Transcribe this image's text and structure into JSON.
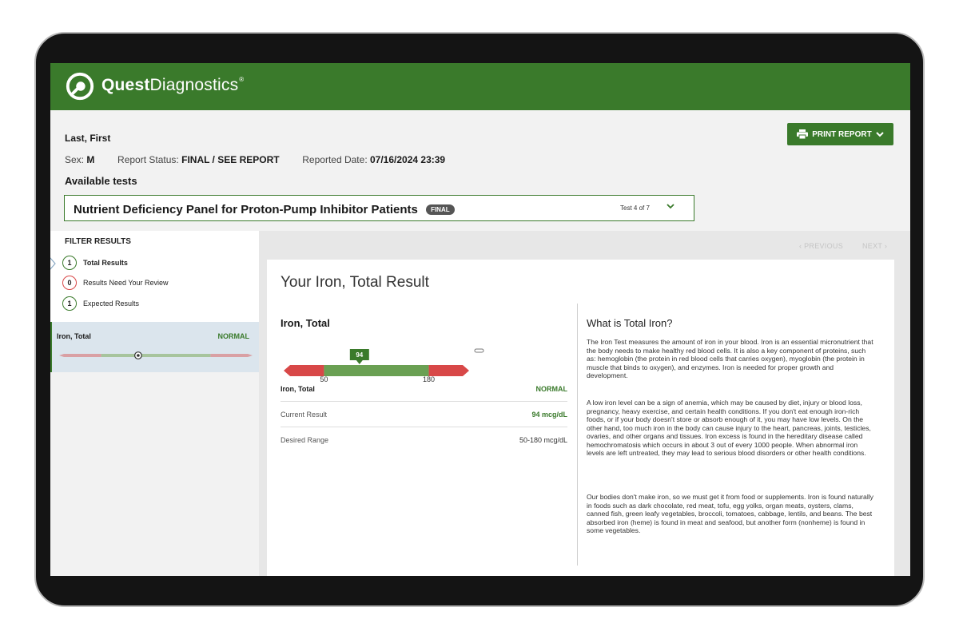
{
  "brand": {
    "name_bold": "Quest",
    "name_light": "Diagnostics",
    "trademark": "®",
    "color": "#3a7a2b"
  },
  "patient": {
    "name": "Last, First",
    "sex_label": "Sex:",
    "sex": "M",
    "status_label": "Report Status:",
    "status": "FINAL / SEE REPORT",
    "date_label": "Reported Date:",
    "date": "07/16/2024 23:39"
  },
  "print_button": {
    "label": "PRINT REPORT"
  },
  "available_tests": {
    "heading": "Available tests",
    "selected": "Nutrient Deficiency Panel for Proton-Pump Inhibitor Patients",
    "badge": "FINAL",
    "count": "Test 4 of 7"
  },
  "filter": {
    "title": "FILTER RESULTS",
    "items": [
      {
        "count": "1",
        "label": "Total Results",
        "color": "#3a7a2b"
      },
      {
        "count": "0",
        "label": "Results Need Your Review",
        "color": "#d84848"
      },
      {
        "count": "1",
        "label": "Expected Results",
        "color": "#3a7a2b"
      }
    ]
  },
  "result_card": {
    "name": "Iron, Total",
    "status": "NORMAL"
  },
  "pager": {
    "previous": "‹ PREVIOUS",
    "next": "NEXT ›"
  },
  "detail": {
    "title": "Your Iron, Total Result",
    "test_name": "Iron, Total",
    "range_chart": {
      "value": 94,
      "low": 50,
      "high": 180,
      "value_label": "94",
      "low_label": "50",
      "high_label": "180"
    },
    "summary": {
      "name": "Iron, Total",
      "status": "NORMAL"
    },
    "current_result": {
      "label": "Current Result",
      "value": "94 mcg/dL"
    },
    "desired_range": {
      "label": "Desired Range",
      "value": "50-180 mcg/dL"
    },
    "info_heading": "What is Total Iron?",
    "paragraphs": [
      "The Iron Test measures the amount of iron in your blood. Iron is an essential micronutrient that the body needs to make healthy red blood cells. It is also a key component of proteins, such as: hemoglobin (the protein in red blood cells that carries oxygen), myoglobin (the protein in muscle that binds to oxygen), and enzymes. Iron is needed for proper growth and development.",
      "A low iron level can be a sign of anemia, which may be caused by diet, injury or blood loss, pregnancy, heavy exercise, and certain health conditions. If you don't eat enough iron-rich foods, or if your body doesn't store or absorb enough of it, you may have low levels. On the other hand, too much iron in the body can cause injury to the heart, pancreas, joints, testicles, ovaries, and other organs and tissues. Iron excess is found in the hereditary disease called hemochromatosis which occurs in about 3 out of every 1000 people. When abnormal iron levels are left untreated, they may lead to serious blood disorders or other health conditions.",
      "Our bodies don't make iron, so we must get it from food or supplements. Iron is found naturally in foods such as dark chocolate, red meat, tofu, egg yolks, organ meats, oysters, clams, canned fish, green leafy vegetables, broccoli, tomatoes, cabbage, lentils, and beans. The best absorbed iron (heme) is found in meat and seafood, but another form (nonheme) is found in some vegetables."
    ]
  },
  "colors": {
    "green": "#3a7a2b",
    "red": "#d84848",
    "range_green": "#6aa053"
  }
}
